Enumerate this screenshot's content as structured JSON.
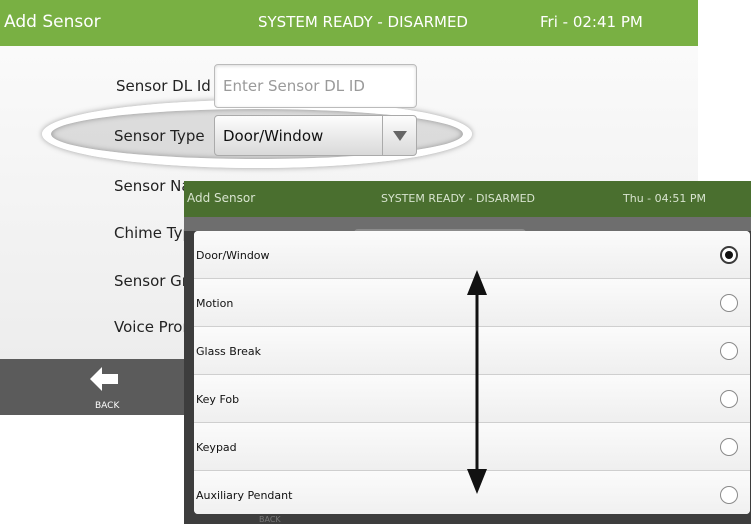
{
  "background_screen": {
    "header": {
      "title": "Add Sensor",
      "status": "SYSTEM READY - DISARMED",
      "datetime": "Fri - 02:41 PM"
    },
    "form": {
      "sensor_dl_id_label": "Sensor DL Id",
      "sensor_dl_id_placeholder": "Enter Sensor DL ID",
      "sensor_type_label": "Sensor Type",
      "sensor_type_value": "Door/Window",
      "sensor_name_label": "Sensor Na",
      "chime_type_label": "Chime Typ",
      "sensor_group_label": "Sensor Gr",
      "voice_prompt_label": "Voice Pror"
    },
    "footer": {
      "back_label": "BACK"
    }
  },
  "popup_screen": {
    "header": {
      "title": "Add Sensor",
      "status": "SYSTEM READY - DISARMED",
      "datetime": "Thu - 04:51 PM"
    },
    "options": [
      {
        "label": "Door/Window",
        "selected": true
      },
      {
        "label": "Motion",
        "selected": false
      },
      {
        "label": "Glass Break",
        "selected": false
      },
      {
        "label": "Key Fob",
        "selected": false
      },
      {
        "label": "Keypad",
        "selected": false
      },
      {
        "label": "Auxiliary Pendant",
        "selected": false
      }
    ],
    "footer": {
      "back_label": "BACK"
    }
  },
  "colors": {
    "header_green": "#79b043",
    "popup_header_green": "#4a6f2f",
    "footer_gray": "#5b5b5b"
  }
}
